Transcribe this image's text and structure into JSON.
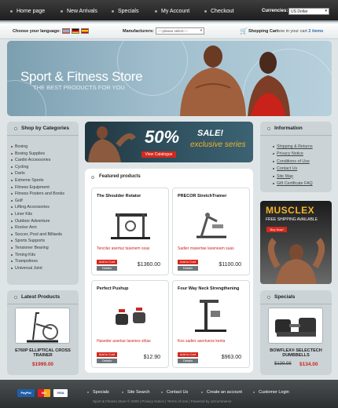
{
  "topnav": {
    "items": [
      "Home page",
      "New Arrivals",
      "Specials",
      "My Account",
      "Checkout"
    ],
    "currency_label": "Currencies:",
    "currency_value": "US Dollar"
  },
  "subbar": {
    "language_label": "Choose your language:",
    "manufacturers_label": "Manufacturers:",
    "manufacturers_value": "----please select----",
    "cart_label": "Shopping Cart",
    "cart_sub": "now in your cart",
    "cart_count": "2",
    "cart_items": "items"
  },
  "banner": {
    "title": "Sport & Fitness Store",
    "subtitle": "THE BEST PRODUCTS FOR YOU"
  },
  "categories": {
    "title": "Shop by Categories",
    "items": [
      "Boxing",
      "Boxing Supplies",
      "Cardio Accessories",
      "Cycling",
      "Darts",
      "Extreme Sports",
      "Fitness Equipment",
      "Fitness Posters and Books",
      "Golf",
      "Lifting Accessories",
      "Liner Kits",
      "Outdoor Adventure",
      "Rocker Arm",
      "Soccer, Pool and Billiards",
      "Sports Supports",
      "Tensioner Bearing",
      "Timing Kits",
      "Trampolines",
      "Universal Joint"
    ]
  },
  "information": {
    "title": "Information",
    "items": [
      "Shipping & Returns",
      "Privacy Notice",
      "Conditions of Use",
      "Contact Us",
      "Site Map",
      "Gift Certificate FAQ"
    ]
  },
  "sale": {
    "percent": "50%",
    "word": "SALE!",
    "tagline": "exclusive series",
    "button": "View Catalogue"
  },
  "featured": {
    "title": "Featured products",
    "add_label": "Add to Cart",
    "details_label": "Details",
    "products": [
      {
        "name": "The Shoulder Rotator",
        "desc": "Tencilar asertuz tasenem sxas",
        "price": "$1360.00"
      },
      {
        "name": "PRECOR StretchTrainer",
        "desc": "Sadier masertae laseneam suas",
        "price": "$1100.00"
      },
      {
        "name": "Perfect Pushup",
        "desc": "Haseder asertue lasenes shlas",
        "price": "$12.90"
      },
      {
        "name": "Four Way Neck Strengthening",
        "desc": "Kes sadier asertueos kenla",
        "price": "$963.00"
      }
    ]
  },
  "musclex": {
    "brand": "MUSCLEX",
    "tagline": "FREE SHIPPING AVAILABLE",
    "button": "Buy Now!"
  },
  "latest": {
    "title": "Latest Products",
    "name": "E760P ELLIPTICAL CROSS TRAINER",
    "price": "$1999.00"
  },
  "specials": {
    "title": "Specials",
    "name": "BOWFLEX® SELECTECH DUMBBELLS",
    "old_price": "$139.98",
    "new_price": "$134.00"
  },
  "footer": {
    "links": [
      "Specials",
      "Site Search",
      "Contact Us",
      "Create an account",
      "Customer Login"
    ],
    "sub": "Sport & Fitness Store © 2009  |  Privacy Notice  |  Terms of Use  |  Powered by osCommerce",
    "cards": [
      "PayPal",
      "MC",
      "VISA"
    ]
  },
  "colors": {
    "accent_red": "#d5281d",
    "nav_dark": "#2a2a2a",
    "panel_grey": "#cbd3d6",
    "sale_orange": "#f3b42a"
  }
}
